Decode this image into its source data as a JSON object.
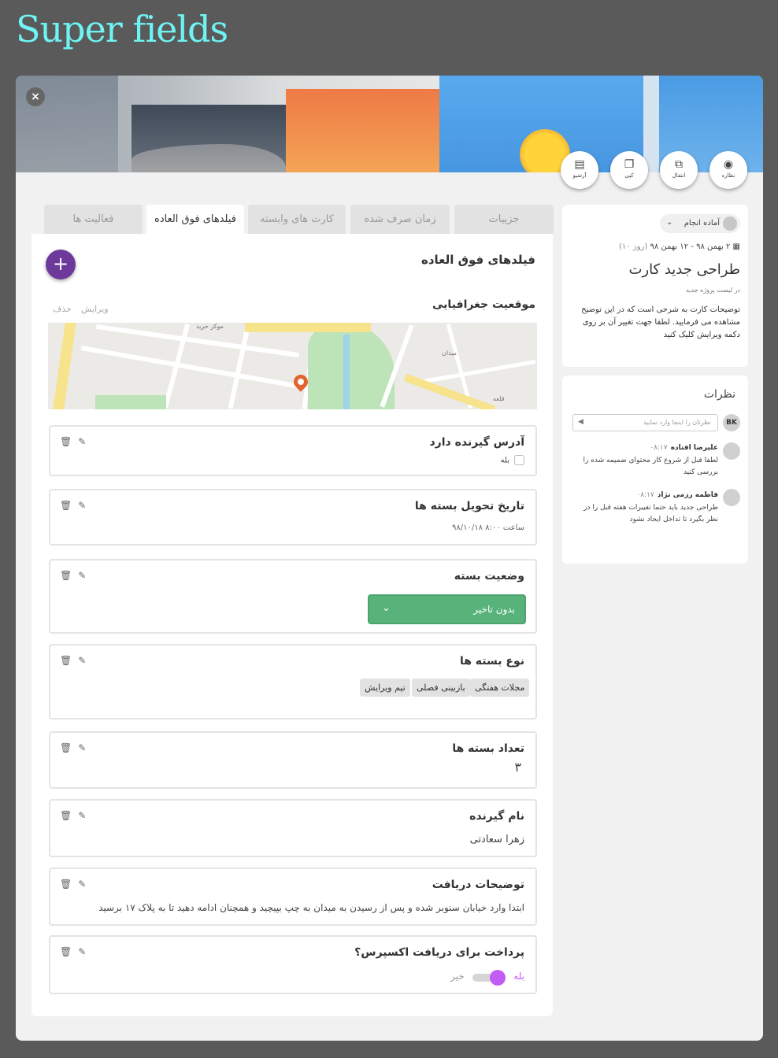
{
  "page_title": "Super fields",
  "close_label": "×",
  "actions": [
    {
      "label": "نظاره",
      "icon": "◉"
    },
    {
      "label": "انتقال",
      "icon": "⧉"
    },
    {
      "label": "کپی",
      "icon": "❐"
    },
    {
      "label": "آرشیو",
      "icon": "▤"
    }
  ],
  "tabs": [
    "جزییات",
    "زمان صرف شده",
    "کارت های وابسته",
    "فیلدهای فوق العاده",
    "فعالیت ها"
  ],
  "main": {
    "title": "فیلدهای فوق العاده",
    "add_label": "+",
    "geo": {
      "title": "موقعیت جغرافیایی",
      "edit": "ویرایش",
      "delete": "حذف",
      "map_labels": [
        "موکز خرید",
        "میدان",
        "قلعه"
      ]
    }
  },
  "fields": {
    "address": {
      "label": "آدرس گیرنده دارد",
      "value": "بله"
    },
    "delivery": {
      "label": "تاریخ تحویل بسته ها",
      "date": "۹۸/۱۰/۱۸",
      "time": "ساعت ۸:۰۰"
    },
    "status": {
      "label": "وضعیت بسته",
      "selected": "بدون تاخیر",
      "chevron": "⌄"
    },
    "types": {
      "label": "نوع بسته ها",
      "tags": [
        "مجلات هفتگی",
        "بازبینی فصلی",
        "تیم ویرایش"
      ]
    },
    "count": {
      "label": "تعداد بسته ها",
      "value": "۳"
    },
    "receiver": {
      "label": "نام گیرنده",
      "value": "زهرا سعادتی"
    },
    "notes": {
      "label": "توضیحات دریافت",
      "value": "ابتدا وارد خیابان سنوبر شده و پس از رسیدن به میدان به چپ بپیچید و همچنان ادامه دهید تا به پلاک ۱۷ برسید"
    },
    "express": {
      "label": "پرداخت برای دریافت اکسپرس؟",
      "yes": "بله",
      "no": "خیر",
      "on": true
    }
  },
  "tools": {
    "delete_icon": "trash-icon",
    "edit_icon": "pencil-icon",
    "delete_glyph": "🗑",
    "edit_glyph": "✎"
  },
  "card": {
    "status": "آماده انجام",
    "status_chevron": "⌄",
    "date": "۲ بهمن ۹۸ - ۱۲ بهمن ۹۸",
    "duration": "(۱۰ روز)",
    "title": "طراحی جدید کارت",
    "list": "در لیست پروژه جدید",
    "description": "توضیحات کارت به شرحی است که در این توضیح مشاهده می فرمایید. لطفا جهت تغییر آن بر روی دکمه ویرایش کلیک کنید"
  },
  "comments": {
    "title": "نظرات",
    "user_initials": "BK",
    "placeholder": "نظرتان را اینجا وارد نمایید",
    "send": "◀",
    "items": [
      {
        "author": "علیرضا افتاده",
        "time": "۰۸:۱۷",
        "text": "لطفا قبل از شروع کار محتوای ضمیمه شده را بررسی کنید"
      },
      {
        "author": "فاطمه رزمی نژاد",
        "time": "۰۸:۱۷",
        "text": "طراحی جدید باید حتما تغییرات هفته قبل را در نظر بگیرد تا تداخل ایجاد نشود"
      }
    ]
  },
  "colors": {
    "accent": "#6d3a9c",
    "status_green": "#58b37a",
    "toggle_on": "#c35cf3",
    "title_cyan": "#6ff3f3"
  }
}
